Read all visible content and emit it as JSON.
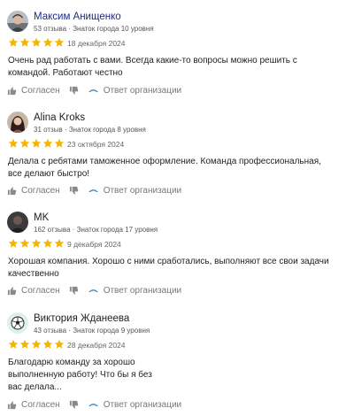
{
  "colors": {
    "star": "#f5b400",
    "text": "#222222",
    "muted": "#777777",
    "org": "#4a8fc7"
  },
  "reviews": [
    {
      "name": "Максим Анищенко",
      "name_color": "#1e2a84",
      "avatar": "photo",
      "meta": "53 отзыва · Знаток города 10 уровня",
      "rating": 5,
      "date": "18 декабря 2024",
      "text": "Очень рад работать с вами. Всегда какие-то вопросы можно решить с командой. Работают честно",
      "agree_label": "Согласен",
      "reply_label": "Ответ организации"
    },
    {
      "name": "Alina Kroks",
      "name_color": "#222222",
      "avatar": "photo",
      "meta": "31 отзыв · Знаток города 8 уровня",
      "rating": 5,
      "date": "23 октября 2024",
      "text": "Делала с ребятами таможенное оформление. Команда профессиональная, все делают быстро!",
      "agree_label": "Согласен",
      "reply_label": "Ответ организации"
    },
    {
      "name": "MK",
      "name_color": "#222222",
      "avatar": "photo",
      "meta": "162 отзыва · Знаток города 17 уровня",
      "rating": 5,
      "date": "9 декабря 2024",
      "text": "Хорошая компания. Хорошо с ними сработались, выполняют все свои задачи качественно",
      "agree_label": "Согласен",
      "reply_label": "Ответ организации"
    },
    {
      "name": "Виктория Жданеева",
      "name_color": "#222222",
      "avatar": "soccer-ball",
      "meta": "43 отзыва · Знаток города 9 уровня",
      "rating": 5,
      "date": "28 декабря 2024",
      "text": "Благодарю команду за хорошо выполненную работу! Что бы я без вас делала...",
      "agree_label": "Согласен",
      "reply_label": "Ответ организации"
    }
  ]
}
